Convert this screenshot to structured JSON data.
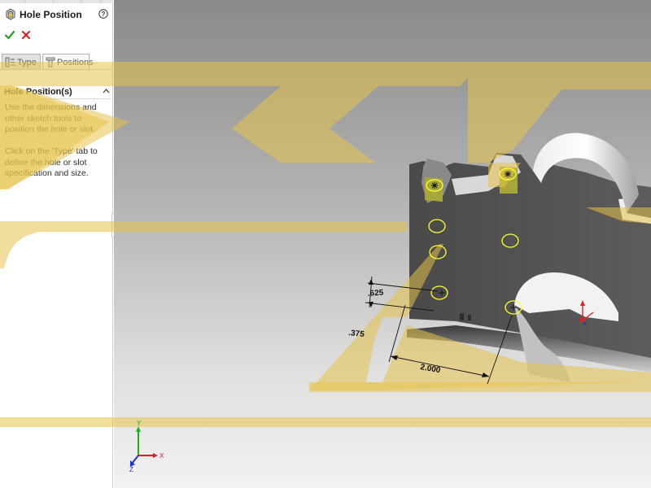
{
  "property_manager": {
    "title": "Hole Position",
    "tabs": [
      {
        "label": "Type",
        "active": false
      },
      {
        "label": "Positions",
        "active": true
      }
    ],
    "section": {
      "title": "Hole Position(s)",
      "paragraphs": [
        "Use the dimensions and other sketch tools to position the hole or slot.",
        "Click on the 'Type' tab to define the hole or slot specification and size."
      ]
    },
    "icons": {
      "feature": "hole-wizard-icon",
      "help": "help-icon",
      "ok": "check-icon",
      "cancel": "x-icon",
      "type_tab": "type-tab-icon",
      "positions_tab": "positions-tab-icon",
      "collapse": "chevron-up-icon"
    }
  },
  "viewport": {
    "dimensions": [
      ".625",
      ".375",
      "2.000"
    ],
    "triad_labels": {
      "x": "X",
      "y": "Y",
      "z": "Z"
    }
  },
  "colors": {
    "accent_yellow": "#e8c34a",
    "ok_green": "#2e9b2e",
    "cancel_red": "#d02020",
    "hole_outline": "#ffff33"
  }
}
